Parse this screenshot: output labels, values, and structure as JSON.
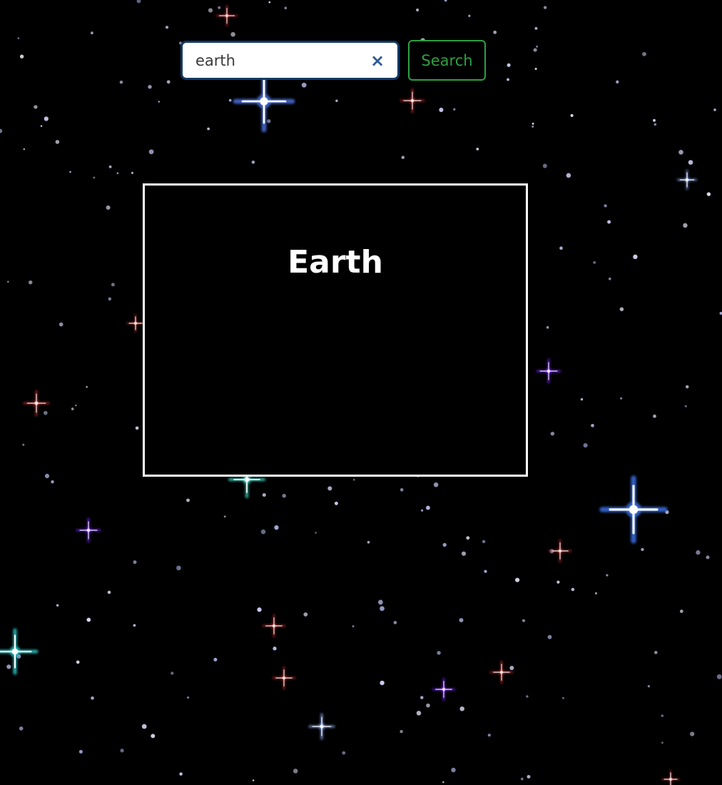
{
  "search": {
    "value": "earth",
    "clear_icon": "×",
    "button_label": "Search"
  },
  "result": {
    "title": "Earth"
  },
  "icons": {
    "clear": "close-icon"
  },
  "colors": {
    "background": "#000000",
    "search_border": "#123a66",
    "clear_icon": "#2d5b99",
    "search_button": "#2ea043",
    "card_border": "#ffffff"
  }
}
